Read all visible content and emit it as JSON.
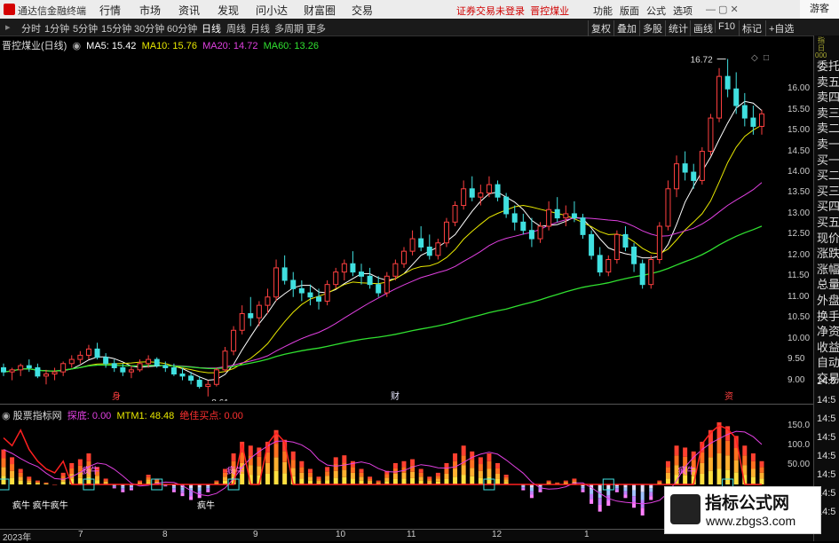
{
  "topbar": {
    "app_name": "通达信金融终端",
    "menu": [
      "行情",
      "市场",
      "资讯",
      "发现",
      "问小达",
      "财富圈",
      "交易"
    ],
    "warning": "证券交易未登录",
    "stock_link": "晋控煤业",
    "right_menu": [
      "功能",
      "版面",
      "公式",
      "选项"
    ],
    "user": "游客"
  },
  "toolbar": {
    "periods": [
      "分时",
      "1分钟",
      "5分钟",
      "15分钟",
      "30分钟",
      "60分钟",
      "日线",
      "周线",
      "月线",
      "多周期",
      "更多"
    ],
    "active_period": "日线",
    "right_buttons": [
      "复权",
      "叠加",
      "多股",
      "统计",
      "画线",
      "F10",
      "标记",
      "+自选"
    ]
  },
  "main_chart": {
    "title": "晋控煤业(日线)",
    "ma": [
      {
        "label": "MA5: 15.42",
        "color": "#ffffff"
      },
      {
        "label": "MA10: 15.76",
        "color": "#e8e800"
      },
      {
        "label": "MA20: 14.72",
        "color": "#e040e0"
      },
      {
        "label": "MA60: 13.26",
        "color": "#30e030"
      }
    ],
    "high_label": "16.72",
    "low_label": "8.61",
    "marker_labels": [
      "身",
      "财",
      "资"
    ],
    "y_ticks": [
      "16.00",
      "15.50",
      "15.00",
      "14.50",
      "14.00",
      "13.50",
      "13.00",
      "12.50",
      "12.00",
      "11.50",
      "11.00",
      "10.50",
      "10.00",
      "9.50",
      "9.00"
    ]
  },
  "indicator": {
    "name": "股票指标网",
    "params": [
      {
        "label": "探底: 0.00",
        "color": "#e040e0"
      },
      {
        "label": "MTM1: 48.48",
        "color": "#e8e800"
      },
      {
        "label": "绝佳买点: 0.00",
        "color": "#ff3030"
      }
    ],
    "y_ticks": [
      "150.0",
      "100.0",
      "50.00"
    ],
    "signal_text": "疯牛",
    "annot_text": [
      "疯牛    疯牛疯牛",
      "疯牛"
    ]
  },
  "dates": [
    "2023年",
    "7",
    "8",
    "9",
    "10",
    "11",
    "12",
    "1"
  ],
  "right_panel": {
    "tabs": [
      "委托",
      "卖五",
      "卖四",
      "卖三",
      "卖二",
      "卖一",
      "买一",
      "买二",
      "买三",
      "买四",
      "买五",
      "现价",
      "涨跌",
      "涨幅",
      "总量",
      "外盘",
      "换手",
      "净资",
      "收益",
      "自动",
      "交易"
    ],
    "top_tiny": [
      "指",
      "日",
      "000"
    ],
    "times": [
      "14:5",
      "14:5",
      "14:5",
      "14:5",
      "14:5",
      "14:5",
      "14:5",
      "14:5"
    ]
  },
  "watermark": {
    "title": "指标公式网",
    "url": "www.zbgs3.com"
  },
  "chart_data": {
    "type": "candlestick",
    "price_range": [
      8.5,
      16.9
    ],
    "ma_series": [
      "MA5",
      "MA10",
      "MA20",
      "MA60"
    ],
    "indicator_range": [
      0,
      160
    ],
    "candles": [
      [
        9.3,
        9.4,
        9.1,
        9.2
      ],
      [
        9.2,
        9.3,
        9.0,
        9.25
      ],
      [
        9.25,
        9.4,
        9.1,
        9.35
      ],
      [
        9.35,
        9.5,
        9.2,
        9.3
      ],
      [
        9.3,
        9.4,
        9.05,
        9.1
      ],
      [
        9.1,
        9.25,
        8.9,
        9.15
      ],
      [
        9.15,
        9.3,
        9.0,
        9.2
      ],
      [
        9.2,
        9.45,
        9.1,
        9.4
      ],
      [
        9.4,
        9.6,
        9.3,
        9.5
      ],
      [
        9.5,
        9.7,
        9.4,
        9.6
      ],
      [
        9.6,
        9.85,
        9.5,
        9.75
      ],
      [
        9.75,
        9.9,
        9.5,
        9.55
      ],
      [
        9.55,
        9.65,
        9.3,
        9.4
      ],
      [
        9.4,
        9.5,
        9.2,
        9.3
      ],
      [
        9.3,
        9.4,
        9.1,
        9.2
      ],
      [
        9.2,
        9.35,
        9.05,
        9.25
      ],
      [
        9.25,
        9.5,
        9.2,
        9.4
      ],
      [
        9.4,
        9.6,
        9.3,
        9.5
      ],
      [
        9.5,
        9.55,
        9.3,
        9.35
      ],
      [
        9.35,
        9.45,
        9.2,
        9.3
      ],
      [
        9.3,
        9.4,
        9.1,
        9.15
      ],
      [
        9.15,
        9.3,
        9.0,
        9.1
      ],
      [
        9.1,
        9.2,
        8.9,
        9.0
      ],
      [
        9.0,
        9.1,
        8.8,
        8.85
      ],
      [
        8.85,
        9.0,
        8.61,
        8.9
      ],
      [
        8.9,
        9.3,
        8.85,
        9.25
      ],
      [
        9.25,
        9.8,
        9.2,
        9.7
      ],
      [
        9.7,
        10.3,
        9.6,
        10.2
      ],
      [
        10.2,
        10.8,
        10.1,
        10.6
      ],
      [
        10.6,
        11.0,
        10.3,
        10.5
      ],
      [
        10.5,
        10.9,
        10.3,
        10.8
      ],
      [
        10.8,
        11.2,
        10.6,
        11.0
      ],
      [
        11.0,
        11.9,
        10.9,
        11.7
      ],
      [
        11.7,
        12.0,
        11.3,
        11.4
      ],
      [
        11.4,
        11.6,
        11.0,
        11.2
      ],
      [
        11.2,
        11.4,
        10.9,
        11.1
      ],
      [
        11.1,
        11.3,
        10.8,
        11.0
      ],
      [
        11.0,
        11.2,
        10.7,
        10.9
      ],
      [
        10.9,
        11.4,
        10.8,
        11.3
      ],
      [
        11.3,
        11.7,
        11.2,
        11.6
      ],
      [
        11.6,
        11.9,
        11.4,
        11.8
      ],
      [
        11.8,
        12.1,
        11.5,
        11.6
      ],
      [
        11.6,
        11.8,
        11.3,
        11.5
      ],
      [
        11.5,
        11.7,
        11.2,
        11.3
      ],
      [
        11.3,
        11.5,
        11.0,
        11.1
      ],
      [
        11.1,
        11.6,
        11.0,
        11.5
      ],
      [
        11.5,
        11.9,
        11.4,
        11.8
      ],
      [
        11.8,
        12.2,
        11.7,
        12.1
      ],
      [
        12.1,
        12.6,
        12.0,
        12.4
      ],
      [
        12.4,
        12.7,
        12.1,
        12.2
      ],
      [
        12.2,
        12.5,
        11.9,
        12.0
      ],
      [
        12.0,
        12.4,
        11.9,
        12.3
      ],
      [
        12.3,
        12.9,
        12.2,
        12.8
      ],
      [
        12.8,
        13.3,
        12.7,
        13.2
      ],
      [
        13.2,
        13.8,
        13.1,
        13.6
      ],
      [
        13.6,
        13.9,
        13.3,
        13.4
      ],
      [
        13.4,
        13.7,
        13.2,
        13.5
      ],
      [
        13.5,
        13.9,
        13.4,
        13.7
      ],
      [
        13.7,
        13.8,
        13.3,
        13.4
      ],
      [
        13.4,
        13.5,
        12.9,
        13.0
      ],
      [
        13.0,
        13.2,
        12.6,
        12.8
      ],
      [
        12.8,
        13.0,
        12.5,
        12.6
      ],
      [
        12.6,
        12.9,
        12.2,
        12.4
      ],
      [
        12.4,
        12.8,
        12.3,
        12.7
      ],
      [
        12.7,
        13.3,
        12.6,
        13.1
      ],
      [
        13.1,
        13.4,
        12.8,
        12.9
      ],
      [
        12.9,
        13.2,
        12.7,
        13.0
      ],
      [
        13.0,
        13.3,
        12.8,
        12.9
      ],
      [
        12.9,
        13.0,
        12.4,
        12.5
      ],
      [
        12.5,
        12.6,
        11.9,
        12.0
      ],
      [
        12.0,
        12.2,
        11.5,
        11.6
      ],
      [
        11.6,
        12.0,
        11.5,
        11.9
      ],
      [
        11.9,
        12.6,
        11.8,
        12.5
      ],
      [
        12.5,
        12.7,
        12.1,
        12.2
      ],
      [
        12.2,
        12.3,
        11.6,
        11.8
      ],
      [
        11.8,
        11.9,
        11.2,
        11.3
      ],
      [
        11.3,
        12.0,
        11.2,
        11.9
      ],
      [
        11.9,
        12.8,
        11.8,
        12.7
      ],
      [
        12.7,
        13.8,
        12.6,
        13.6
      ],
      [
        13.6,
        14.4,
        13.4,
        14.2
      ],
      [
        14.2,
        14.5,
        13.8,
        14.0
      ],
      [
        14.0,
        14.2,
        13.6,
        13.8
      ],
      [
        13.8,
        14.6,
        13.7,
        14.5
      ],
      [
        14.5,
        15.4,
        14.4,
        15.3
      ],
      [
        15.3,
        16.5,
        15.2,
        16.3
      ],
      [
        16.3,
        16.72,
        15.8,
        16.0
      ],
      [
        16.0,
        16.4,
        15.4,
        15.6
      ],
      [
        15.6,
        15.9,
        15.1,
        15.3
      ],
      [
        15.3,
        15.6,
        14.9,
        15.1
      ],
      [
        15.1,
        15.5,
        14.9,
        15.4
      ]
    ],
    "mtm_values": [
      90,
      70,
      40,
      20,
      10,
      5,
      0,
      30,
      55,
      65,
      80,
      45,
      15,
      -10,
      -20,
      -15,
      10,
      25,
      15,
      -5,
      -20,
      -30,
      -40,
      -35,
      -20,
      10,
      40,
      80,
      110,
      100,
      95,
      110,
      140,
      115,
      85,
      60,
      40,
      20,
      45,
      70,
      75,
      60,
      40,
      20,
      10,
      35,
      55,
      60,
      65,
      40,
      20,
      30,
      55,
      80,
      100,
      85,
      70,
      80,
      55,
      25,
      0,
      -15,
      -35,
      -20,
      10,
      5,
      10,
      15,
      -20,
      -50,
      -70,
      -55,
      -20,
      -35,
      -60,
      -80,
      -40,
      10,
      60,
      100,
      95,
      85,
      110,
      140,
      160,
      150,
      125,
      100,
      80,
      60
    ],
    "signals": [
      0,
      10,
      18,
      27,
      57,
      71,
      85
    ]
  }
}
